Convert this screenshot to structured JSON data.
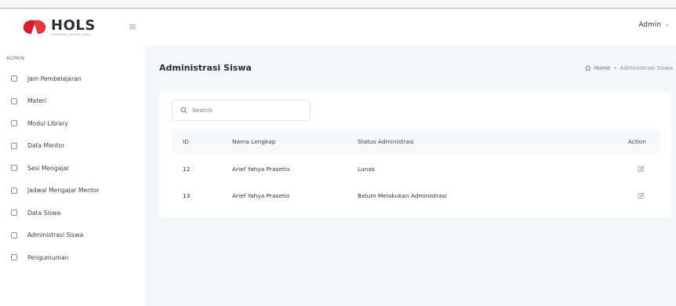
{
  "app": {
    "logo_title": "HOLS",
    "logo_tagline": "hospitality learning space",
    "brand_color": "#d81e2c"
  },
  "header": {
    "user_label": "Admin",
    "icons": {
      "menu_toggle": "menu-toggle-icon",
      "user_dropdown": "chevron-down-icon"
    }
  },
  "sidebar": {
    "heading": "ADMIN",
    "items": [
      {
        "label": "Jam Pembelajaran"
      },
      {
        "label": "Materi"
      },
      {
        "label": "Modul Library"
      },
      {
        "label": "Data Mentor"
      },
      {
        "label": "Sesi Mengajar"
      },
      {
        "label": "Jadwal Mengajar Mentor"
      },
      {
        "label": "Data Siswa"
      },
      {
        "label": "Administrasi Siswa"
      },
      {
        "label": "Pengumuman"
      }
    ]
  },
  "page": {
    "title": "Administrasi Siswa",
    "breadcrumb": {
      "home": "Home",
      "separator": "•",
      "current": "Administrasi Siswa"
    }
  },
  "search": {
    "placeholder": "Search",
    "value": ""
  },
  "table": {
    "columns": {
      "id": "ID",
      "name": "Nama Lengkap",
      "status": "Status Administrasi",
      "action": "Action"
    },
    "rows": [
      {
        "id": "12",
        "name": "Arief Yahya Prasetio",
        "status": "Lunas"
      },
      {
        "id": "13",
        "name": "Arief Yahya Prasetio",
        "status": "Belum Melakukan Administrasi"
      }
    ]
  }
}
